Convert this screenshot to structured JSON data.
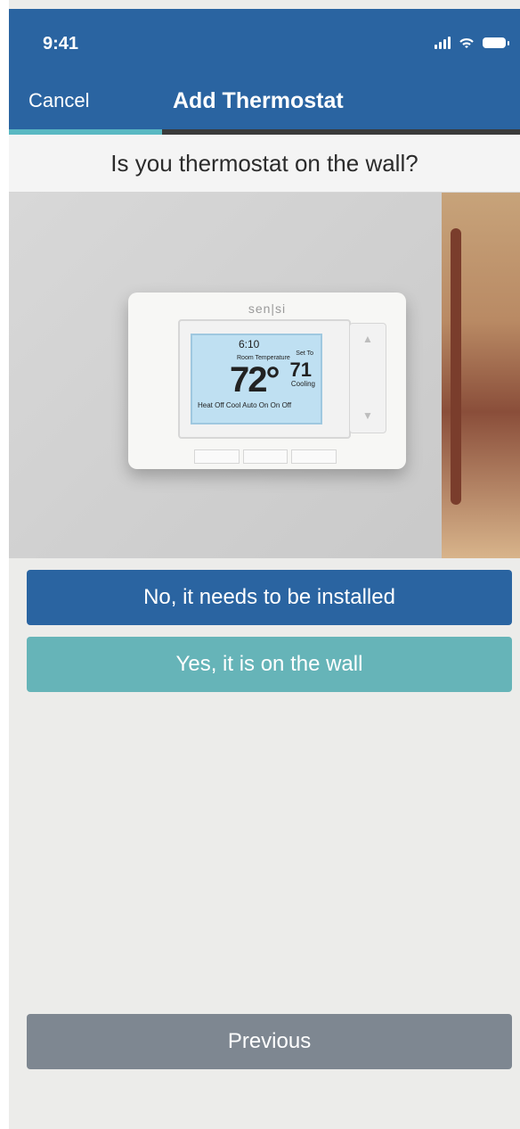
{
  "status": {
    "time": "9:41"
  },
  "header": {
    "cancel_label": "Cancel",
    "title": "Add Thermostat",
    "progress": 0.3
  },
  "question": {
    "text": "Is you thermostat on the wall?"
  },
  "image": {
    "brand_text": "sen|si",
    "lcd": {
      "clock": "6:10",
      "room_label": "Room Temperature",
      "room_temp": "72°",
      "set_label": "Set To",
      "set_temp": "71",
      "mode": "Cooling",
      "bottom_row": "Heat Off Cool  Auto On  On Off"
    }
  },
  "actions": {
    "primary_label": "No, it needs to be installed",
    "secondary_label": "Yes, it is on the wall",
    "previous_label": "Previous"
  },
  "colors": {
    "header_bg": "#2a64a1",
    "progress_fill": "#59b8c2",
    "primary_button": "#2a64a1",
    "secondary_button": "#66b4b8",
    "previous_button": "#7e8791"
  }
}
